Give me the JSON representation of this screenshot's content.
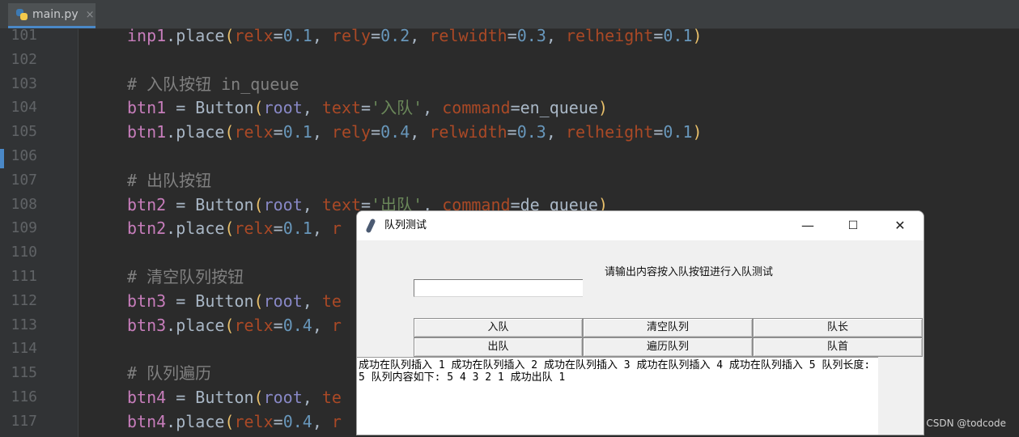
{
  "editor": {
    "tab_label": "main.py",
    "tab_close": "×",
    "lines": [
      {
        "no": "101",
        "tokens": [
          [
            "var",
            "inp1"
          ],
          [
            "",
            "."
          ],
          [
            "",
            "place"
          ],
          [
            "paren",
            "("
          ],
          [
            "kw",
            "relx"
          ],
          [
            "",
            "="
          ],
          [
            "num",
            "0.1"
          ],
          [
            "",
            ", "
          ],
          [
            "kw",
            "rely"
          ],
          [
            "",
            "="
          ],
          [
            "num",
            "0.2"
          ],
          [
            "",
            ", "
          ],
          [
            "kw",
            "relwidth"
          ],
          [
            "",
            "="
          ],
          [
            "num",
            "0.3"
          ],
          [
            "",
            ", "
          ],
          [
            "kw",
            "relheight"
          ],
          [
            "",
            "="
          ],
          [
            "num",
            "0.1"
          ],
          [
            "paren",
            ")"
          ]
        ]
      },
      {
        "no": "102",
        "tokens": []
      },
      {
        "no": "103",
        "tokens": [
          [
            "comment",
            "# 入队按钮 in_queue"
          ]
        ]
      },
      {
        "no": "104",
        "tokens": [
          [
            "var",
            "btn1"
          ],
          [
            "",
            " = Button"
          ],
          [
            "paren",
            "("
          ],
          [
            "root",
            "root"
          ],
          [
            "",
            ", "
          ],
          [
            "kw",
            "text"
          ],
          [
            "",
            "="
          ],
          [
            "str",
            "'入队'"
          ],
          [
            "",
            ", "
          ],
          [
            "kw",
            "command"
          ],
          [
            "",
            "=en_queue"
          ],
          [
            "paren",
            ")"
          ]
        ]
      },
      {
        "no": "105",
        "tokens": [
          [
            "var",
            "btn1"
          ],
          [
            "",
            ".place"
          ],
          [
            "paren",
            "("
          ],
          [
            "kw",
            "relx"
          ],
          [
            "",
            "="
          ],
          [
            "num",
            "0.1"
          ],
          [
            "",
            ", "
          ],
          [
            "kw",
            "rely"
          ],
          [
            "",
            "="
          ],
          [
            "num",
            "0.4"
          ],
          [
            "",
            ", "
          ],
          [
            "kw",
            "relwidth"
          ],
          [
            "",
            "="
          ],
          [
            "num",
            "0.3"
          ],
          [
            "",
            ", "
          ],
          [
            "kw",
            "relheight"
          ],
          [
            "",
            "="
          ],
          [
            "num",
            "0.1"
          ],
          [
            "paren",
            ")"
          ]
        ]
      },
      {
        "no": "106",
        "tokens": []
      },
      {
        "no": "107",
        "tokens": [
          [
            "comment",
            "# 出队按钮"
          ]
        ]
      },
      {
        "no": "108",
        "tokens": [
          [
            "var",
            "btn2"
          ],
          [
            "",
            " = Button"
          ],
          [
            "paren",
            "("
          ],
          [
            "root",
            "root"
          ],
          [
            "",
            ", "
          ],
          [
            "kw",
            "text"
          ],
          [
            "",
            "="
          ],
          [
            "str",
            "'出队'"
          ],
          [
            "",
            ", "
          ],
          [
            "kw",
            "command"
          ],
          [
            "",
            "=de_queue"
          ],
          [
            "paren",
            ")"
          ]
        ]
      },
      {
        "no": "109",
        "tokens": [
          [
            "var",
            "btn2"
          ],
          [
            "",
            ".place"
          ],
          [
            "paren",
            "("
          ],
          [
            "kw",
            "relx"
          ],
          [
            "",
            "="
          ],
          [
            "num",
            "0.1"
          ],
          [
            "",
            ", "
          ],
          [
            "kw",
            "r"
          ]
        ]
      },
      {
        "no": "110",
        "tokens": []
      },
      {
        "no": "111",
        "tokens": [
          [
            "comment",
            "# 清空队列按钮"
          ]
        ]
      },
      {
        "no": "112",
        "tokens": [
          [
            "var",
            "btn3"
          ],
          [
            "",
            " = Button"
          ],
          [
            "paren",
            "("
          ],
          [
            "root",
            "root"
          ],
          [
            "",
            ", "
          ],
          [
            "kw",
            "te"
          ]
        ]
      },
      {
        "no": "113",
        "tokens": [
          [
            "var",
            "btn3"
          ],
          [
            "",
            ".place"
          ],
          [
            "paren",
            "("
          ],
          [
            "kw",
            "relx"
          ],
          [
            "",
            "="
          ],
          [
            "num",
            "0.4"
          ],
          [
            "",
            ", "
          ],
          [
            "kw",
            "r"
          ]
        ]
      },
      {
        "no": "114",
        "tokens": []
      },
      {
        "no": "115",
        "tokens": [
          [
            "comment",
            "# 队列遍历"
          ]
        ]
      },
      {
        "no": "116",
        "tokens": [
          [
            "var",
            "btn4"
          ],
          [
            "",
            " = Button"
          ],
          [
            "paren",
            "("
          ],
          [
            "root",
            "root"
          ],
          [
            "",
            ", "
          ],
          [
            "kw",
            "te"
          ]
        ]
      },
      {
        "no": "117",
        "tokens": [
          [
            "var",
            "btn4"
          ],
          [
            "",
            ".place"
          ],
          [
            "paren",
            "("
          ],
          [
            "kw",
            "relx"
          ],
          [
            "",
            "="
          ],
          [
            "num",
            "0.4"
          ],
          [
            "",
            ", "
          ],
          [
            "kw",
            "r"
          ]
        ]
      }
    ]
  },
  "dialog": {
    "title": "队列测试",
    "minimize": "—",
    "maximize": "☐",
    "close": "✕",
    "prompt": "请输出内容按入队按钮进行入队测试",
    "entry_value": "",
    "buttons": {
      "enqueue": "入队",
      "clear": "清空队列",
      "length": "队长",
      "dequeue": "出队",
      "traverse": "遍历队列",
      "head": "队首"
    },
    "output": " 成功在队列插入 1 成功在队列插入 2 成功在队列插入 3 成功在队列插入 4 成功在队列插入 5 队列长度: 5 队列内容如下: 5 4 3 2 1  成功出队 1"
  },
  "watermark": "CSDN @todcode"
}
